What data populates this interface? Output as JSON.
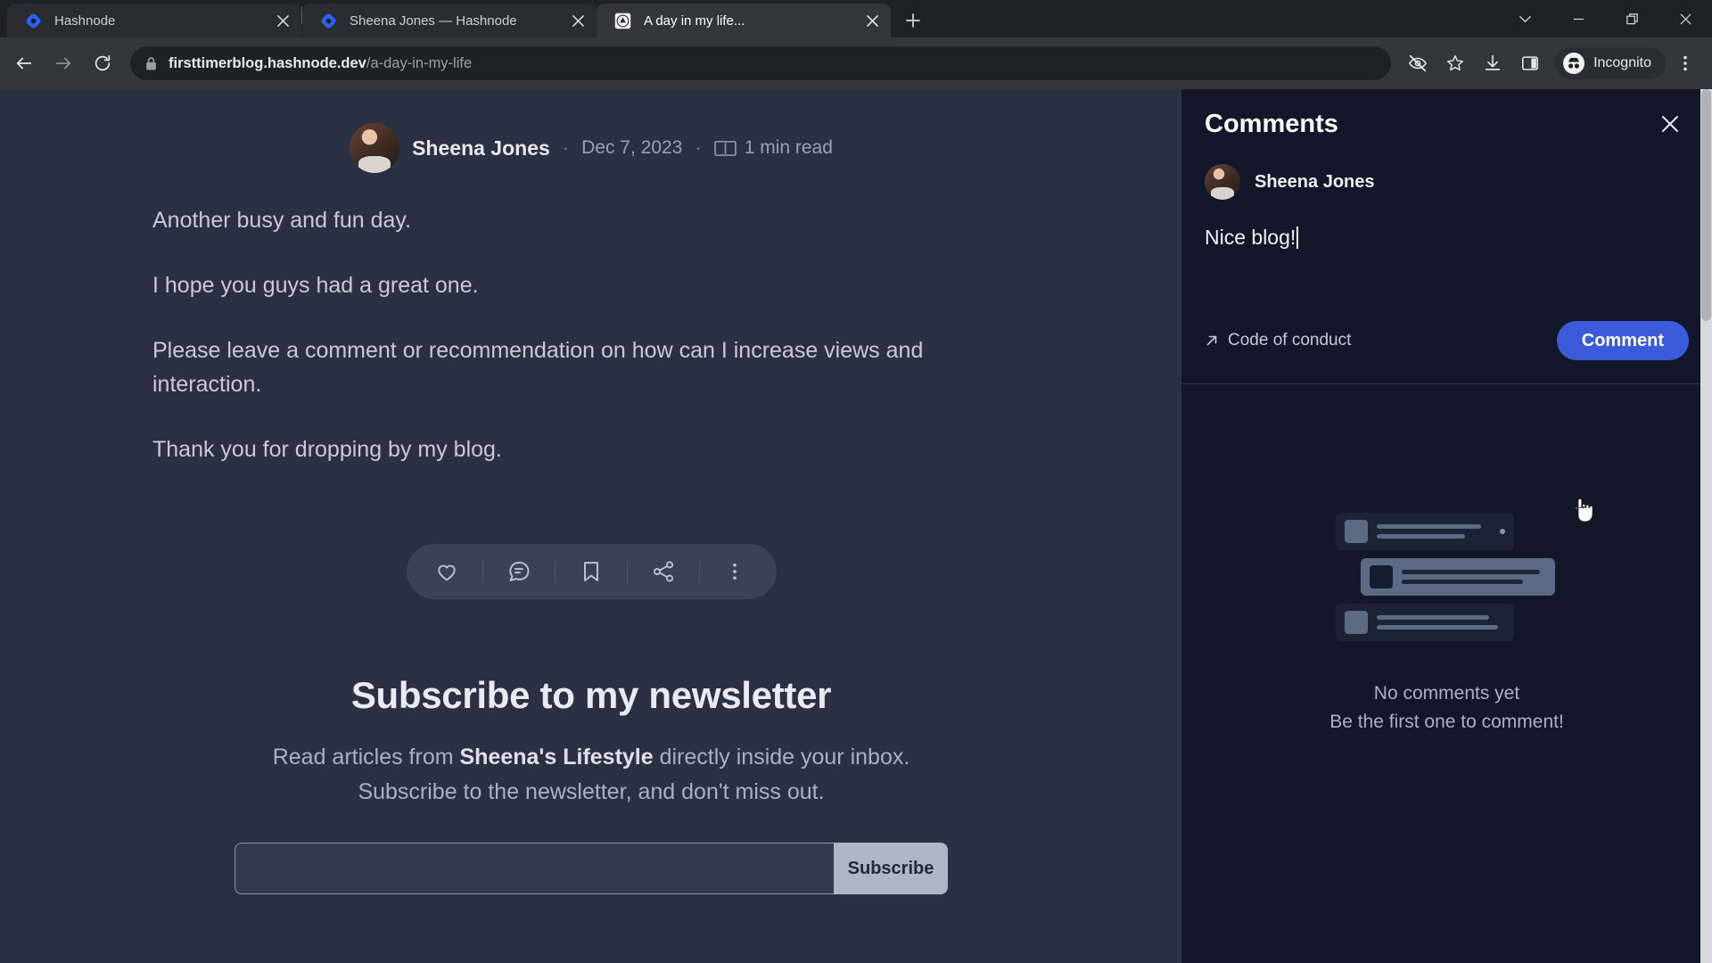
{
  "browser": {
    "tabs": [
      {
        "title": "Hashnode",
        "favicon": "hashnode-icon",
        "active": false
      },
      {
        "title": "Sheena Jones — Hashnode",
        "favicon": "hashnode-icon",
        "active": false
      },
      {
        "title": "A day in my life...",
        "favicon": "blog-icon",
        "active": true
      }
    ],
    "new_tab_label": "+",
    "window_controls": {
      "tab_search": "tab-search-icon",
      "minimize": "minimize-icon",
      "maximize": "restore-icon",
      "close": "close-icon"
    },
    "toolbar": {
      "back": "back-arrow-icon",
      "forward": "forward-arrow-icon",
      "reload": "reload-icon",
      "lock": "lock-icon",
      "url_domain": "firsttimerblog.hashnode.dev",
      "url_path": "/a-day-in-my-life",
      "tracking_protection": "eye-slash-icon",
      "bookmark": "star-icon",
      "downloads": "download-icon",
      "side_panel": "side-panel-icon",
      "incognito_label": "Incognito",
      "menu": "three-dot-menu-icon"
    }
  },
  "article": {
    "author": "Sheena Jones",
    "separator": "·",
    "date": "Dec 7, 2023",
    "read_time": "1 min read",
    "read_icon": "book-icon",
    "paragraphs": [
      "Another busy and fun day.",
      "I hope you guys had a great one.",
      "Please leave a comment or recommendation on how can I increase views and interaction.",
      "Thank you for dropping by my blog."
    ],
    "actions": [
      {
        "name": "like",
        "icon": "heart-icon"
      },
      {
        "name": "comment",
        "icon": "comment-bubble-icon"
      },
      {
        "name": "bookmark",
        "icon": "bookmark-icon"
      },
      {
        "name": "share",
        "icon": "share-icon"
      },
      {
        "name": "more",
        "icon": "three-dot-icon"
      }
    ]
  },
  "newsletter": {
    "heading": "Subscribe to my newsletter",
    "description_before": "Read articles from ",
    "blog_name": "Sheena's Lifestyle",
    "description_after": " directly inside your inbox. Subscribe to the newsletter, and don't miss out.",
    "email_placeholder": "",
    "subscribe_label": "Subscribe"
  },
  "comments_panel": {
    "title": "Comments",
    "close_icon": "close-icon",
    "user_name": "Sheena Jones",
    "draft_text": "Nice blog!",
    "code_of_conduct": "Code of conduct",
    "code_of_conduct_icon": "arrow-up-right-icon",
    "submit_label": "Comment",
    "submit_color": "#3b5bdb",
    "empty_title": "No comments yet",
    "empty_subtitle": "Be the first one to comment!"
  }
}
